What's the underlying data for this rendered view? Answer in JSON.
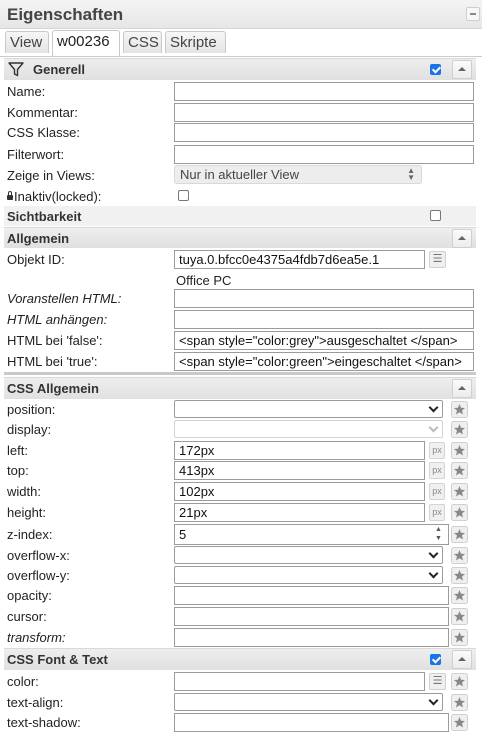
{
  "panel": {
    "title": "Eigenschaften"
  },
  "tabs": [
    {
      "label": "View"
    },
    {
      "label": "w00236"
    },
    {
      "label": "CSS"
    },
    {
      "label": "Skripte"
    }
  ],
  "generell": {
    "title": "Generell",
    "checked": true,
    "fields": {
      "name": {
        "label": "Name:",
        "value": ""
      },
      "kommentar": {
        "label": "Kommentar:",
        "value": ""
      },
      "css_klasse": {
        "label": "CSS Klasse:",
        "value": ""
      },
      "filterwort": {
        "label": "Filterwort:",
        "value": ""
      },
      "zeige_in_views": {
        "label": "Zeige in Views:",
        "value": "Nur in aktueller View"
      },
      "inaktiv": {
        "label": "Inaktiv(locked):",
        "checked": false
      }
    }
  },
  "sichtbarkeit": {
    "title": "Sichtbarkeit",
    "checked": false
  },
  "allgemein": {
    "title": "Allgemein",
    "objekt_id": {
      "label": "Objekt ID:",
      "value": "tuya.0.bfcc0e4375a4fdb7d6ea5e.1"
    },
    "object_name": "Office PC",
    "voranstellen_html": {
      "label": "Voranstellen HTML:",
      "value": ""
    },
    "html_anhaengen": {
      "label": "HTML anhängen:",
      "value": ""
    },
    "html_false": {
      "label": "HTML bei 'false':",
      "value": "<span style=\"color:grey\">ausgeschaltet </span>"
    },
    "html_true": {
      "label": "HTML bei 'true':",
      "value": "<span style=\"color:green\">eingeschaltet </span>"
    }
  },
  "css_allgemein": {
    "title": "CSS Allgemein",
    "position": {
      "label": "position:",
      "value": ""
    },
    "display": {
      "label": "display:",
      "value": ""
    },
    "left": {
      "label": "left:",
      "value": "172px",
      "unit": "px"
    },
    "top": {
      "label": "top:",
      "value": "413px",
      "unit": "px"
    },
    "width": {
      "label": "width:",
      "value": "102px",
      "unit": "px"
    },
    "height": {
      "label": "height:",
      "value": "21px",
      "unit": "px"
    },
    "z_index": {
      "label": "z-index:",
      "value": "5"
    },
    "overflow_x": {
      "label": "overflow-x:",
      "value": ""
    },
    "overflow_y": {
      "label": "overflow-y:",
      "value": ""
    },
    "opacity": {
      "label": "opacity:",
      "value": ""
    },
    "cursor": {
      "label": "cursor:",
      "value": ""
    },
    "transform": {
      "label": "transform:",
      "value": ""
    }
  },
  "css_font_text": {
    "title": "CSS Font & Text",
    "checked": true,
    "color": {
      "label": "color:",
      "value": ""
    },
    "text_align": {
      "label": "text-align:",
      "value": ""
    },
    "text_shadow": {
      "label": "text-shadow:",
      "value": ""
    }
  },
  "colors": {
    "accent": "#1a73e8",
    "section_bg": "#e6e6e6"
  },
  "icons": {
    "filter": "filter-icon",
    "star": "star-icon",
    "lock": "lock-icon",
    "id_picker": "list-icon"
  }
}
